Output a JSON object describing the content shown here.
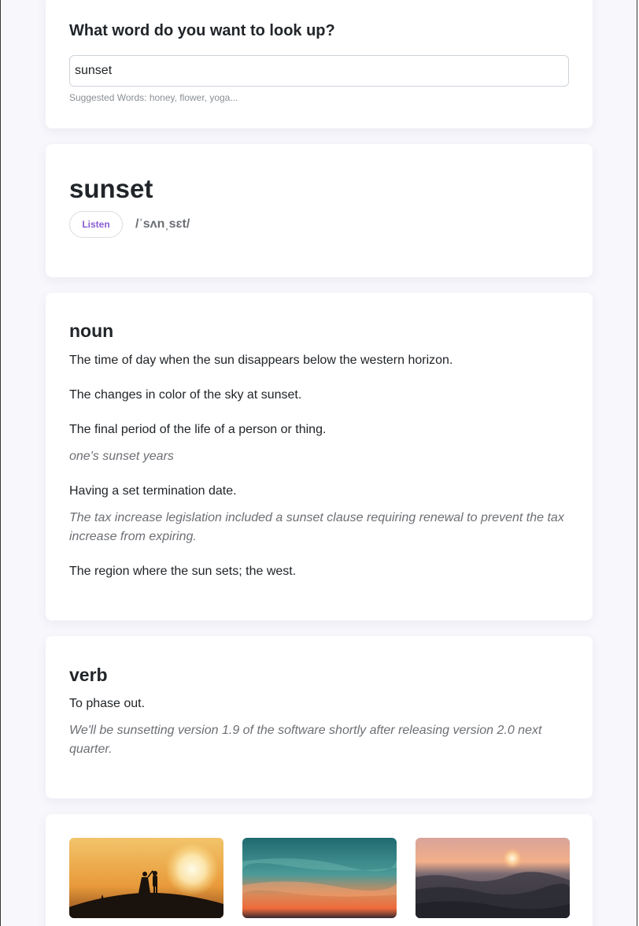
{
  "search": {
    "heading": "What word do you want to look up?",
    "value": "sunset",
    "suggestions": "Suggested Words: honey, flower, yoga..."
  },
  "entry": {
    "word": "sunset",
    "listen_label": "Listen",
    "phonetic": "/ˈsʌnˌsɛt/"
  },
  "meanings": [
    {
      "part_of_speech": "noun",
      "definitions": [
        {
          "text": "The time of day when the sun disappears below the western horizon."
        },
        {
          "text": "The changes in color of the sky at sunset."
        },
        {
          "text": "The final period of the life of a person or thing.",
          "example": "one's sunset years"
        },
        {
          "text": "Having a set termination date.",
          "example": "The tax increase legislation included a sunset clause requiring renewal to prevent the tax increase from expiring."
        },
        {
          "text": "The region where the sun sets; the west."
        }
      ]
    },
    {
      "part_of_speech": "verb",
      "definitions": [
        {
          "text": "To phase out.",
          "example": "We'll be sunsetting version 1.9 of the software shortly after releasing version 2.0 next quarter."
        }
      ]
    }
  ],
  "photos": [
    {
      "subject": "silhouette-couple-sunset-photo"
    },
    {
      "subject": "teal-orange-sky-photo"
    },
    {
      "subject": "ocean-waves-sunset-photo"
    }
  ],
  "colors": {
    "accent": "#8a5cd6",
    "page_background": "#f8f7fc",
    "muted_text": "#6c6f74"
  }
}
